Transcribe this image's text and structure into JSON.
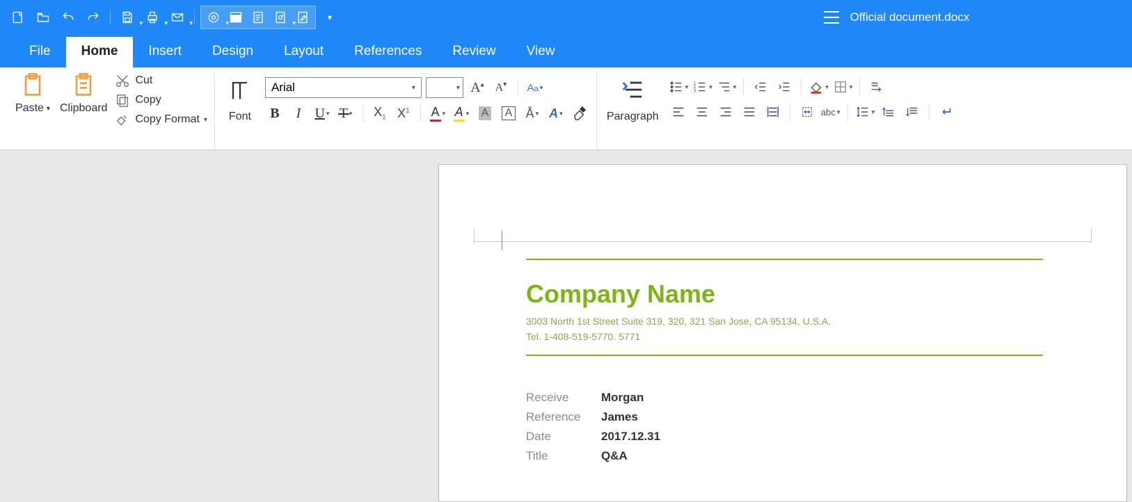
{
  "app": {
    "title": "Official document.docx"
  },
  "menu": {
    "tabs": [
      "File",
      "Home",
      "Insert",
      "Design",
      "Layout",
      "References",
      "Review",
      "View"
    ],
    "active_index": 1
  },
  "ribbon": {
    "paste_label": "Paste",
    "clipboard_label": "Clipboard",
    "cut_label": "Cut",
    "copy_label": "Copy",
    "copyformat_label": "Copy Format",
    "font_label": "Font",
    "font_name": "Arial",
    "font_size": "",
    "paragraph_label": "Paragraph"
  },
  "doc": {
    "company_title": "Company Name",
    "address": "3003 North 1st Street Suite 319, 320, 321 San Jose, CA 95134, U.S.A.",
    "tel": "Tel. 1-408-519-5770. 5771",
    "meta": [
      {
        "k": "Receive",
        "v": "Morgan"
      },
      {
        "k": "Reference",
        "v": "James"
      },
      {
        "k": "Date",
        "v": "2017.12.31"
      },
      {
        "k": "Title",
        "v": "Q&A"
      }
    ]
  }
}
